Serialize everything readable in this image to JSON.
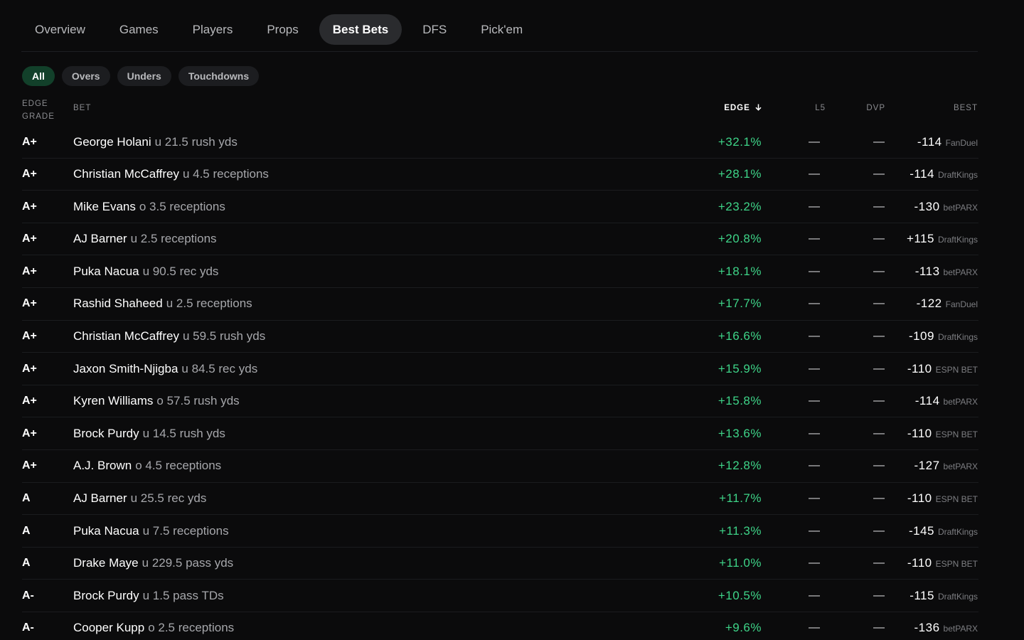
{
  "nav": {
    "tabs": [
      {
        "label": "Overview",
        "active": false
      },
      {
        "label": "Games",
        "active": false
      },
      {
        "label": "Players",
        "active": false
      },
      {
        "label": "Props",
        "active": false
      },
      {
        "label": "Best Bets",
        "active": true
      },
      {
        "label": "DFS",
        "active": false
      },
      {
        "label": "Pick'em",
        "active": false
      }
    ]
  },
  "filters": [
    {
      "label": "All",
      "active": true
    },
    {
      "label": "Overs",
      "active": false
    },
    {
      "label": "Unders",
      "active": false
    },
    {
      "label": "Touchdowns",
      "active": false
    }
  ],
  "table": {
    "headers": {
      "grade_line1": "EDGE",
      "grade_line2": "GRADE",
      "bet": "BET",
      "edge": "EDGE",
      "edge_sort_icon": "arrow-down-icon",
      "l5": "L5",
      "dvp": "DVP",
      "best": "BEST"
    },
    "rows": [
      {
        "grade": "A+",
        "player": "George Holani",
        "line": "u 21.5 rush yds",
        "edge": "+32.1%",
        "l5": "—",
        "dvp": "—",
        "odds": "-114",
        "book": "FanDuel"
      },
      {
        "grade": "A+",
        "player": "Christian McCaffrey",
        "line": "u 4.5 receptions",
        "edge": "+28.1%",
        "l5": "—",
        "dvp": "—",
        "odds": "-114",
        "book": "DraftKings"
      },
      {
        "grade": "A+",
        "player": "Mike Evans",
        "line": "o 3.5 receptions",
        "edge": "+23.2%",
        "l5": "—",
        "dvp": "—",
        "odds": "-130",
        "book": "betPARX"
      },
      {
        "grade": "A+",
        "player": "AJ Barner",
        "line": "u 2.5 receptions",
        "edge": "+20.8%",
        "l5": "—",
        "dvp": "—",
        "odds": "+115",
        "book": "DraftKings"
      },
      {
        "grade": "A+",
        "player": "Puka Nacua",
        "line": "u 90.5 rec yds",
        "edge": "+18.1%",
        "l5": "—",
        "dvp": "—",
        "odds": "-113",
        "book": "betPARX"
      },
      {
        "grade": "A+",
        "player": "Rashid Shaheed",
        "line": "u 2.5 receptions",
        "edge": "+17.7%",
        "l5": "—",
        "dvp": "—",
        "odds": "-122",
        "book": "FanDuel"
      },
      {
        "grade": "A+",
        "player": "Christian McCaffrey",
        "line": "u 59.5 rush yds",
        "edge": "+16.6%",
        "l5": "—",
        "dvp": "—",
        "odds": "-109",
        "book": "DraftKings"
      },
      {
        "grade": "A+",
        "player": "Jaxon Smith-Njigba",
        "line": "u 84.5 rec yds",
        "edge": "+15.9%",
        "l5": "—",
        "dvp": "—",
        "odds": "-110",
        "book": "ESPN BET"
      },
      {
        "grade": "A+",
        "player": "Kyren Williams",
        "line": "o 57.5 rush yds",
        "edge": "+15.8%",
        "l5": "—",
        "dvp": "—",
        "odds": "-114",
        "book": "betPARX"
      },
      {
        "grade": "A+",
        "player": "Brock Purdy",
        "line": "u 14.5 rush yds",
        "edge": "+13.6%",
        "l5": "—",
        "dvp": "—",
        "odds": "-110",
        "book": "ESPN BET"
      },
      {
        "grade": "A+",
        "player": "A.J. Brown",
        "line": "o 4.5 receptions",
        "edge": "+12.8%",
        "l5": "—",
        "dvp": "—",
        "odds": "-127",
        "book": "betPARX"
      },
      {
        "grade": "A",
        "player": "AJ Barner",
        "line": "u 25.5 rec yds",
        "edge": "+11.7%",
        "l5": "—",
        "dvp": "—",
        "odds": "-110",
        "book": "ESPN BET"
      },
      {
        "grade": "A",
        "player": "Puka Nacua",
        "line": "u 7.5 receptions",
        "edge": "+11.3%",
        "l5": "—",
        "dvp": "—",
        "odds": "-145",
        "book": "DraftKings"
      },
      {
        "grade": "A",
        "player": "Drake Maye",
        "line": "u 229.5 pass yds",
        "edge": "+11.0%",
        "l5": "—",
        "dvp": "—",
        "odds": "-110",
        "book": "ESPN BET"
      },
      {
        "grade": "A-",
        "player": "Brock Purdy",
        "line": "u 1.5 pass TDs",
        "edge": "+10.5%",
        "l5": "—",
        "dvp": "—",
        "odds": "-115",
        "book": "DraftKings"
      },
      {
        "grade": "A-",
        "player": "Cooper Kupp",
        "line": "o 2.5 receptions",
        "edge": "+9.6%",
        "l5": "—",
        "dvp": "—",
        "odds": "-136",
        "book": "betPARX"
      }
    ]
  }
}
